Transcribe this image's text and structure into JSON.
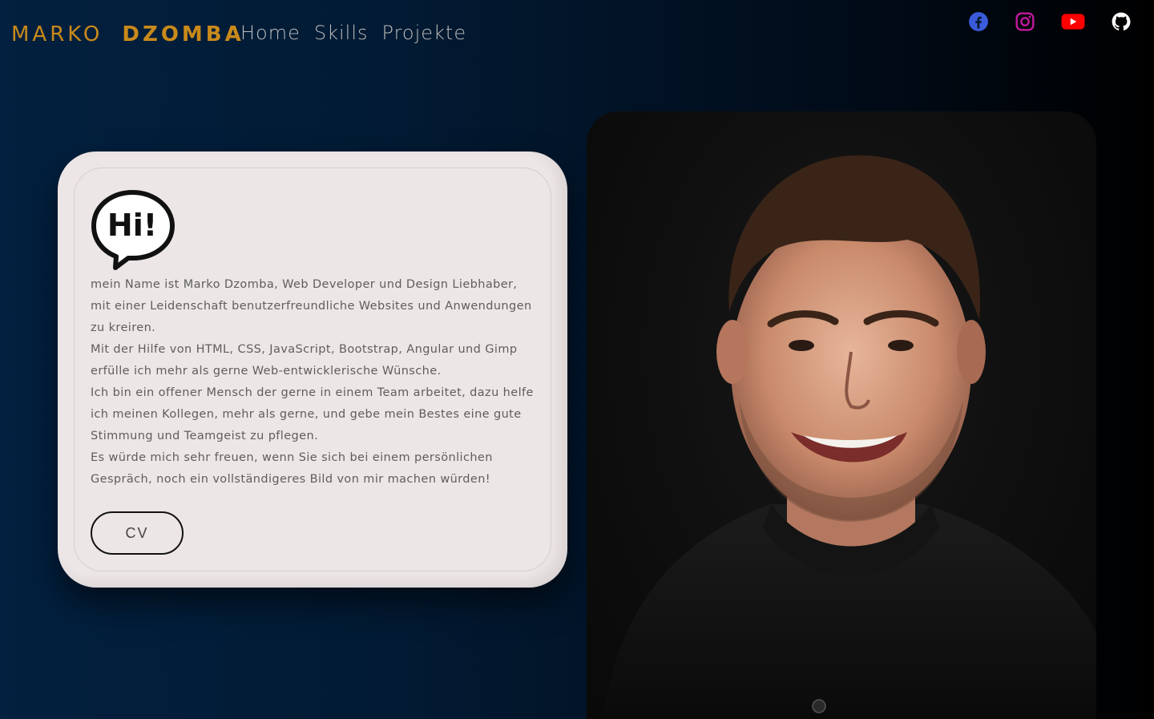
{
  "header": {
    "logo": [
      "MARKO",
      "DZOMBA"
    ],
    "nav": [
      "Home",
      "Skills",
      "Projekte"
    ]
  },
  "social": [
    {
      "name": "facebook",
      "color": "#3b5bdb"
    },
    {
      "name": "instagram",
      "color": "#c2189f"
    },
    {
      "name": "youtube",
      "color": "#ff0000"
    },
    {
      "name": "github",
      "color": "#ffffff"
    }
  ],
  "card": {
    "bubble_text": "Hi!",
    "paragraphs": [
      "mein Name ist Marko Dzomba,  Web Developer und Design Liebhaber,  mit einer Leidenschaft benutzerfreundliche Websites und Anwendungen zu kreiren.",
      "Mit der Hilfe von HTML,  CSS,  JavaScript,  Bootstrap,  Angular und Gimp erfülle ich mehr als gerne Web-entwicklerische Wünsche.",
      "Ich bin ein offener Mensch der gerne in einem Team arbeitet,   dazu helfe ich meinen Kollegen,  mehr als gerne,  und gebe mein Bestes eine gute Stimmung und Teamgeist zu pflegen.",
      "Es würde mich sehr freuen,   wenn Sie sich bei einem persönlichen Gespräch,   noch ein vollständigeres Bild von mir machen würden!"
    ],
    "cv_label": "CV"
  },
  "accent": "#c98a1a"
}
